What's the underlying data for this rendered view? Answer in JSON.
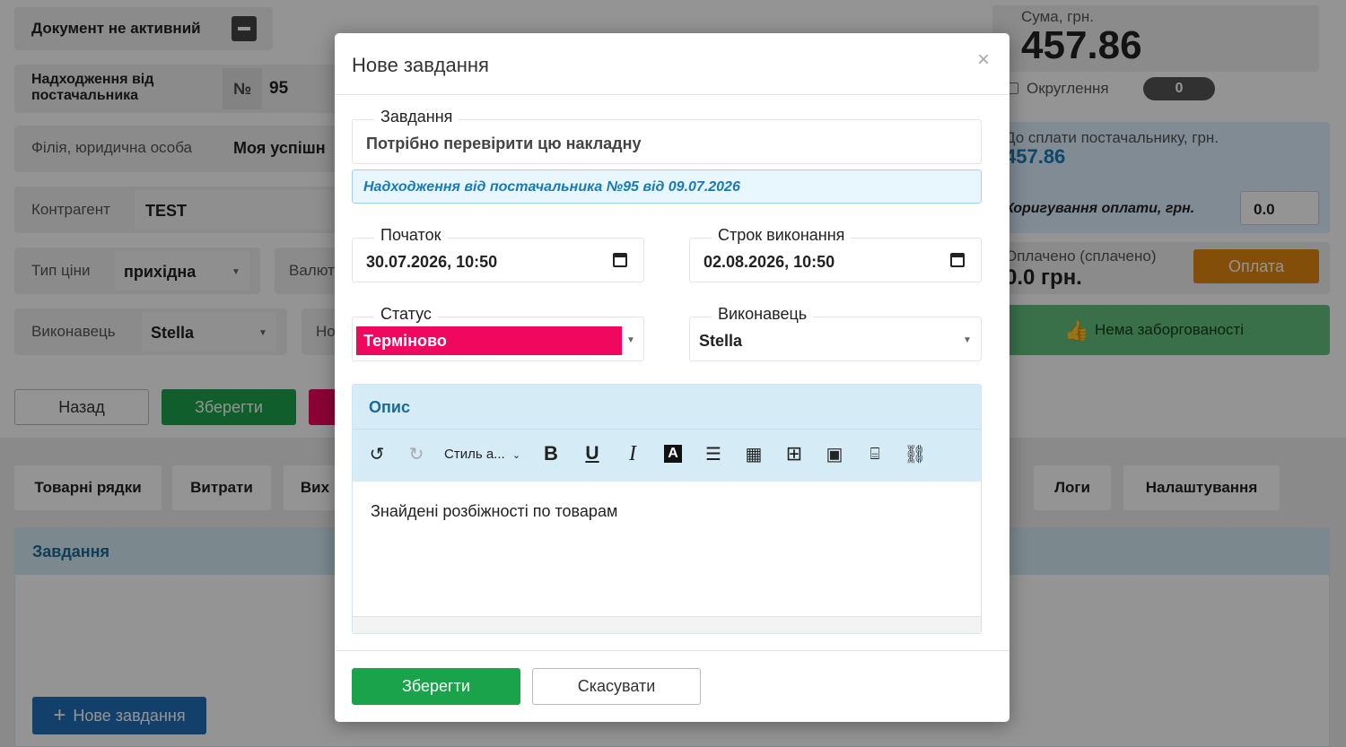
{
  "background": {
    "doc_status_label": "Документ не активний",
    "receipt_label": "Надходження від постачальника",
    "number_prefix": "№",
    "number_value": "95",
    "branch_label": "Філія, юридична особа",
    "branch_value": "Моя успішн",
    "counterparty_label": "Контрагент",
    "counterparty_value": "TEST",
    "price_type_label": "Тип ціни",
    "price_type_value": "прихідна",
    "currency_label": "Валют",
    "executor_label": "Виконавець",
    "executor_value": "Stella",
    "extra_label": "Но",
    "sum_label": "Сума, грн.",
    "sum_value": "457.86",
    "rounding_label": "Округлення",
    "rounding_value": "0",
    "to_pay_label": "До сплати постачальнику, грн.",
    "to_pay_value": "457.86",
    "correction_label": "Коригування оплати, грн.",
    "correction_value": "0.0",
    "paid_label": "Оплачено (сплачено)",
    "paid_value": "0.0 грн.",
    "pay_button": "Оплата",
    "no_debt_label": "Нема заборгованості",
    "back_button": "Назад",
    "save_button": "Зберегти",
    "tabs": [
      "Товарні рядки",
      "Витрати",
      "Вих",
      "Логи",
      "Налаштування"
    ],
    "tasks_header": "Завдання",
    "new_task_button": "Нове завдання"
  },
  "modal": {
    "title": "Нове завдання",
    "close": "×",
    "task_legend": "Завдання",
    "task_value": "Потрібно перевірити цю накладну",
    "link_text": "Надходження від постачальника №95 від 09.07.2026",
    "start_legend": "Початок",
    "start_value": "30.07.2026, 10:50",
    "due_legend": "Строк виконання",
    "due_value": "02.08.2026, 10:50",
    "status_legend": "Статус",
    "status_value": "Терміново",
    "executor_legend": "Виконавець",
    "executor_value": "Stella",
    "description_header": "Опис",
    "style_dropdown": "Стиль а...",
    "editor_text": "Знайдені розбіжності по товарам",
    "save_button": "Зберегти",
    "cancel_button": "Скасувати"
  },
  "colors": {
    "green": "#1aa34a",
    "status_pink": "#f0085e",
    "link_blue": "#1a7ab8",
    "info_bg": "#d5ecf6",
    "pay_orange": "#e2870f"
  }
}
